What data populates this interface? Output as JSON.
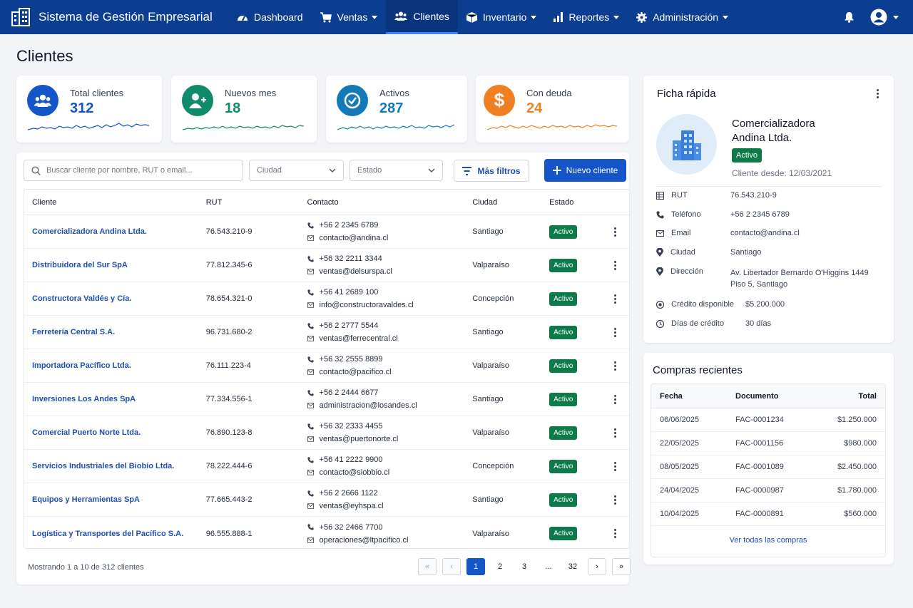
{
  "app": {
    "title": "Sistema de Gestión Empresarial"
  },
  "nav": [
    {
      "label": "Dashboard",
      "icon": "dashboard-icon",
      "dropdown": false,
      "active": false
    },
    {
      "label": "Ventas",
      "icon": "cart-icon",
      "dropdown": true,
      "active": false
    },
    {
      "label": "Clientes",
      "icon": "users-icon",
      "dropdown": false,
      "active": true
    },
    {
      "label": "Inventario",
      "icon": "box-icon",
      "dropdown": true,
      "active": false
    },
    {
      "label": "Reportes",
      "icon": "bar-chart-icon",
      "dropdown": true,
      "active": false
    },
    {
      "label": "Administración",
      "icon": "gear-icon",
      "dropdown": true,
      "active": false
    }
  ],
  "page": {
    "title": "Clientes"
  },
  "stats": [
    {
      "label": "Total clientes",
      "value": "312",
      "color": "#1456c8",
      "icon": "users-icon"
    },
    {
      "label": "Nuevos mes",
      "value": "18",
      "color": "#0f8a6a",
      "icon": "user-plus-icon"
    },
    {
      "label": "Activos",
      "value": "287",
      "color": "#1479b8",
      "icon": "check-circle-icon"
    },
    {
      "label": "Con deuda",
      "value": "24",
      "color": "#f07f22",
      "icon": "dollar-icon"
    }
  ],
  "toolbar": {
    "search_placeholder": "Buscar cliente por nombre, RUT o email...",
    "city_select": "Ciudad",
    "status_select": "Estado",
    "more_filters": "Más filtros",
    "new_client": "Nuevo cliente"
  },
  "table": {
    "headers": [
      "Cliente",
      "RUT",
      "Contacto",
      "Ciudad",
      "Estado"
    ],
    "rows": [
      {
        "name": "Comercializadora Andina Ltda.",
        "rut": "76.543.210-9",
        "phone": "+56 2 2345 6789",
        "email": "contacto@andina.cl",
        "city": "Santiago",
        "status": "Activo"
      },
      {
        "name": "Distribuidora del Sur SpA",
        "rut": "77.812.345-6",
        "phone": "+56 32 2211 3344",
        "email": "ventas@delsurspa.cl",
        "city": "Valparaíso",
        "status": "Activo"
      },
      {
        "name": "Constructora Valdés y Cía.",
        "rut": "78.654.321-0",
        "phone": "+56 41 2689 100",
        "email": "info@constructoravaldes.cl",
        "city": "Concepción",
        "status": "Activo"
      },
      {
        "name": "Ferretería Central S.A.",
        "rut": "96.731.680-2",
        "phone": "+56 2 2777 5544",
        "email": "ventas@ferrecentral.cl",
        "city": "Santiago",
        "status": "Activo"
      },
      {
        "name": "Importadora Pacífico Ltda.",
        "rut": "76.111.223-4",
        "phone": "+56 32 2555 8899",
        "email": "contacto@pacifico.cl",
        "city": "Valparaíso",
        "status": "Activo"
      },
      {
        "name": "Inversiones Los Andes SpA",
        "rut": "77.334.556-1",
        "phone": "+56 2 2444 6677",
        "email": "administracion@losandes.cl",
        "city": "Santiago",
        "status": "Activo"
      },
      {
        "name": "Comercial Puerto Norte Ltda.",
        "rut": "76.890.123-8",
        "phone": "+56 32 2333 4455",
        "email": "ventas@puertonorte.cl",
        "city": "Valparaíso",
        "status": "Activo"
      },
      {
        "name": "Servicios Industriales del Biobío Ltda.",
        "rut": "78.222.444-6",
        "phone": "+56 41 2222 9900",
        "email": "contacto@siobbio.cl",
        "city": "Concepción",
        "status": "Activo"
      },
      {
        "name": "Equipos y Herramientas SpA",
        "rut": "77.665.443-2",
        "phone": "+56 2 2666 1122",
        "email": "ventas@eyhspa.cl",
        "city": "Santiago",
        "status": "Activo"
      },
      {
        "name": "Logística y Transportes del Pacífico S.A.",
        "rut": "96.555.888-1",
        "phone": "+56 32 2466 7700",
        "email": "operaciones@ltpacifico.cl",
        "city": "Valparaíso",
        "status": "Activo"
      }
    ]
  },
  "footer": {
    "info": "Mostrando 1 a 10 de 312 clientes"
  },
  "pagination": {
    "pages": [
      "1",
      "2",
      "3",
      "...",
      "32"
    ],
    "current": "1"
  },
  "quick": {
    "title": "Ficha rápida",
    "name_line1": "Comercializadora",
    "name_line2": "Andina Ltda.",
    "status": "Activo",
    "since_label": "Cliente desde:",
    "since_value": "12/03/2021",
    "fields": [
      {
        "icon": "id-card-icon",
        "label": "RUT",
        "value": "76.543.210-9"
      },
      {
        "icon": "phone-icon",
        "label": "Teléfono",
        "value": "+56 2 2345 6789"
      },
      {
        "icon": "mail-icon",
        "label": "Email",
        "value": "contacto@andina.cl"
      },
      {
        "icon": "pin-icon",
        "label": "Ciudad",
        "value": "Santiago"
      },
      {
        "icon": "pin-icon",
        "label": "Dirección",
        "value": "Av. Libertador Bernardo O'Higgins 1449",
        "value2": "Piso 5, Santiago"
      },
      {
        "icon": "credit-icon",
        "label": "Crédito disponible",
        "value": "$5.200.000"
      },
      {
        "icon": "clock-icon",
        "label": "Días de crédito",
        "value": "30 días"
      }
    ]
  },
  "purchases": {
    "title": "Compras recientes",
    "headers": [
      "Fecha",
      "Documento",
      "Total"
    ],
    "rows": [
      {
        "date": "06/06/2025",
        "doc": "FAC-0001234",
        "total": "$1.250.000"
      },
      {
        "date": "22/05/2025",
        "doc": "FAC-0001156",
        "total": "$980.000"
      },
      {
        "date": "08/05/2025",
        "doc": "FAC-0001089",
        "total": "$2.450.000"
      },
      {
        "date": "24/04/2025",
        "doc": "FAC-0000987",
        "total": "$1.780.000"
      },
      {
        "date": "10/04/2025",
        "doc": "FAC-0000891",
        "total": "$560.000"
      }
    ],
    "view_all": "Ver todas las compras"
  }
}
